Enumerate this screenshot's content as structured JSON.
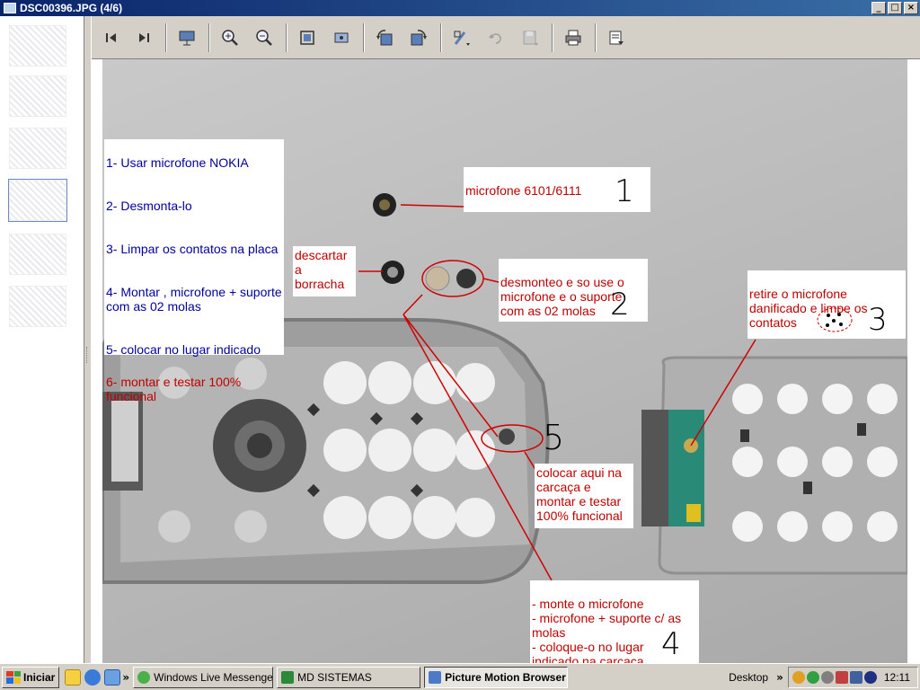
{
  "window": {
    "title": "DSC00396.JPG (4/6)"
  },
  "titlebar_buttons": [
    "_",
    "□",
    "×"
  ],
  "photo_notes": {
    "steps": [
      "1- Usar microfone NOKIA",
      "2- Desmonta-lo",
      "3- Limpar os contatos na placa",
      "4- Montar , microfone + suporte com as 02 molas",
      "5- colocar no lugar indicado",
      "6- montar e testar 100% funcional"
    ],
    "n1_text": "microfone 6101/6111",
    "n1_num": "1",
    "discard_text": "descartar\na\nborracha",
    "n2_text": "desmonteo e so use o\nmicrofone e o suporte\ncom as 02 molas",
    "n2_num": "2",
    "n3_text": "retire o microfone\ndanificado e limpe os\ncontatos",
    "n3_num": "3",
    "n5_num": "5",
    "place_text": "colocar aqui na\ncarcaça e\nmontar e testar\n100% funcional",
    "n4_text": "- monte o microfone\n- microfone + suporte c/ as\nmolas\n- coloque-o no lugar\nindicado na carcaça",
    "n4_num": "4"
  },
  "taskbar": {
    "start_label": "Iniciar",
    "chevron": "»",
    "tasks": [
      {
        "label": "Windows Live Messenger"
      },
      {
        "label": "MD SISTEMAS"
      },
      {
        "label": "Picture Motion Browser"
      }
    ],
    "desktop_label": "Desktop",
    "clock": "12:11"
  },
  "colors": {
    "annotation_red": "#c00000",
    "steps_blue": "#0000a0",
    "titlebar": "#0a246a"
  }
}
